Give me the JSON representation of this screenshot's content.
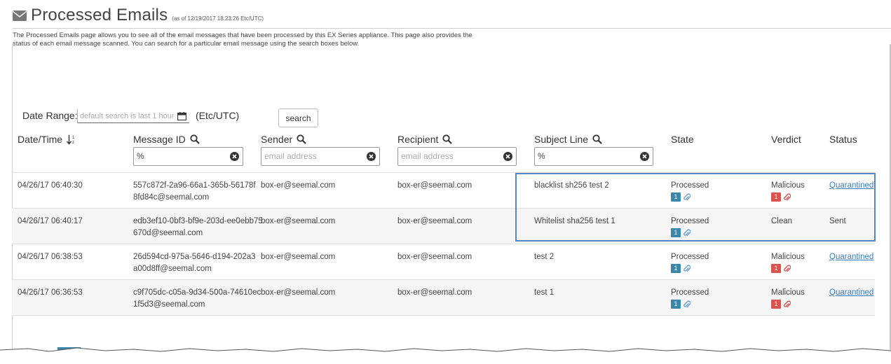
{
  "header": {
    "title": "Processed Emails",
    "as_of": "(as of 12/19/2017 18:23:26 Etc/UTC)",
    "description": "The Processed Emails page allows you to see all of the email messages that have been processed by this EX Series appliance. This page also provides the status of each email message scanned. You can search for a particular email message using the search boxes below."
  },
  "filters": {
    "date_range_label": "Date Range:",
    "date_placeholder": "default search is last 1 hour",
    "timezone": "(Etc/UTC)",
    "search_button": "search",
    "message_id_value": "%",
    "sender_placeholder": "email address",
    "recipient_placeholder": "email address",
    "subject_value": "%"
  },
  "columns": {
    "datetime": "Date/Time",
    "message_id": "Message ID",
    "sender": "Sender",
    "recipient": "Recipient",
    "subject": "Subject Line",
    "state": "State",
    "verdict": "Verdict",
    "status": "Status"
  },
  "rows": [
    {
      "datetime": "04/26/17 06:40:30",
      "message_id_1": "557c872f-2a96-66a1-365b-56178f",
      "message_id_2": "8fd84c@seemal.com",
      "sender": "box-er@seemal.com",
      "recipient": "box-er@seemal.com",
      "subject": "blacklist sh256 test 2",
      "state": "Processed",
      "state_count": "1",
      "verdict": "Malicious",
      "verdict_count": "1",
      "status": "Quarantined"
    },
    {
      "datetime": "04/26/17 06:40:17",
      "message_id_1": "edb3ef10-0bf3-bf9e-203d-ee0ebb75",
      "message_id_2": "670d@seemal.com",
      "sender": "box-er@seemal.com",
      "recipient": "box-er@seemal.com",
      "subject": "Whitelist sha256 test 1",
      "state": "Processed",
      "state_count": "1",
      "verdict": "Clean",
      "verdict_count": "",
      "status": "Sent"
    },
    {
      "datetime": "04/26/17 06:38:53",
      "message_id_1": "26d594cd-975a-5646-d194-202a3",
      "message_id_2": "a00d8ff@seemal.com",
      "sender": "box-er@seemal.com",
      "recipient": "box-er@seemal.com",
      "subject": "test 2",
      "state": "Processed",
      "state_count": "1",
      "verdict": "Malicious",
      "verdict_count": "1",
      "status": "Quarantined"
    },
    {
      "datetime": "04/26/17 06:36:53",
      "message_id_1": "c9f705dc-c05a-9d34-500a-74610ec",
      "message_id_2": "1f5d3@seemal.com",
      "sender": "box-er@seemal.com",
      "recipient": "box-er@seemal.com",
      "subject": "test 1",
      "state": "Processed",
      "state_count": "1",
      "verdict": "Malicious",
      "verdict_count": "1",
      "status": "Quarantined"
    }
  ],
  "colors": {
    "chip_blue": "#3a87ad",
    "chip_red": "#d9534f",
    "link": "#3a7bbf",
    "highlight": "#5b84c4"
  },
  "icons": [
    "envelope-icon",
    "calendar-icon",
    "sort-icon",
    "search-icon",
    "clear-icon",
    "paperclip-icon"
  ]
}
